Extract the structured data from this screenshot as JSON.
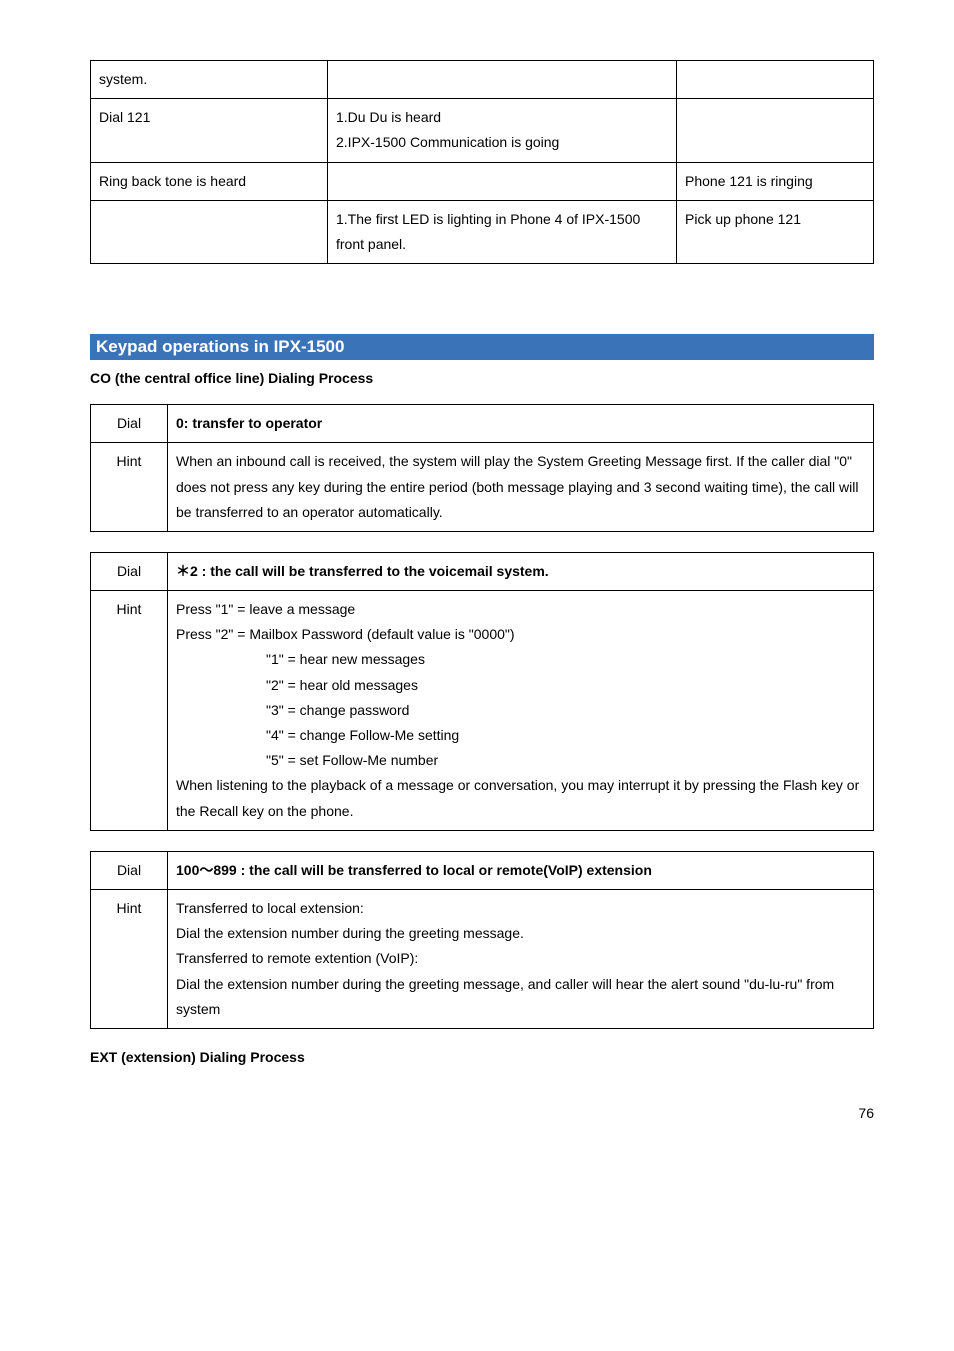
{
  "table1": {
    "rows": [
      {
        "c1": "system.",
        "c2": "",
        "c3": ""
      },
      {
        "c1": "Dial 121",
        "c2": "1.Du Du is heard\n2.IPX-1500 Communication is going",
        "c3": ""
      },
      {
        "c1": "Ring back tone is heard",
        "c2": "",
        "c3": "Phone 121 is ringing"
      },
      {
        "c1": "",
        "c2": "1.The first LED is lighting in Phone 4 of IPX-1500 front panel.",
        "c3": "Pick up phone 121"
      }
    ]
  },
  "section": {
    "title": "Keypad operations in IPX-1500",
    "co_title": "CO (the central office line) Dialing Process",
    "ext_title": "EXT (extension) Dialing Process"
  },
  "labels": {
    "dial": "Dial",
    "hint": "Hint"
  },
  "table2": {
    "dial": "0: transfer to operator",
    "hint": "When an inbound call is received, the system will play the System Greeting Message first. If the caller dial \"0\" does not press any key during the entire period (both message playing and 3 second waiting time), the call will be transferred to an operator automatically."
  },
  "table3": {
    "dial": "＊2 : the call will be transferred to the voicemail system.",
    "hint_l1": "Press \"1\" = leave a message",
    "hint_l2": "Press \"2\" = Mailbox Password (default value is \"0000\")",
    "hint_l3": "\"1\" = hear new messages",
    "hint_l4": "\"2\" = hear old messages",
    "hint_l5": "\"3\" = change password",
    "hint_l6": "\"4\" = change Follow-Me setting",
    "hint_l7": "\"5\" = set Follow-Me number",
    "hint_l8": "When listening to the playback of a message or conversation, you may interrupt it by pressing the Flash key or the Recall key on the phone."
  },
  "table4": {
    "dial": "100～899 : the call will be transferred to local or remote(VoIP) extension",
    "hint_l1": "Transferred to local extension:",
    "hint_l2": "Dial the extension number during the greeting message.",
    "hint_l3": "Transferred to remote extention (VoIP):",
    "hint_l4": "Dial the extension number during the greeting message, and caller will hear the alert sound \"du-lu-ru\" from system"
  },
  "page": "76"
}
